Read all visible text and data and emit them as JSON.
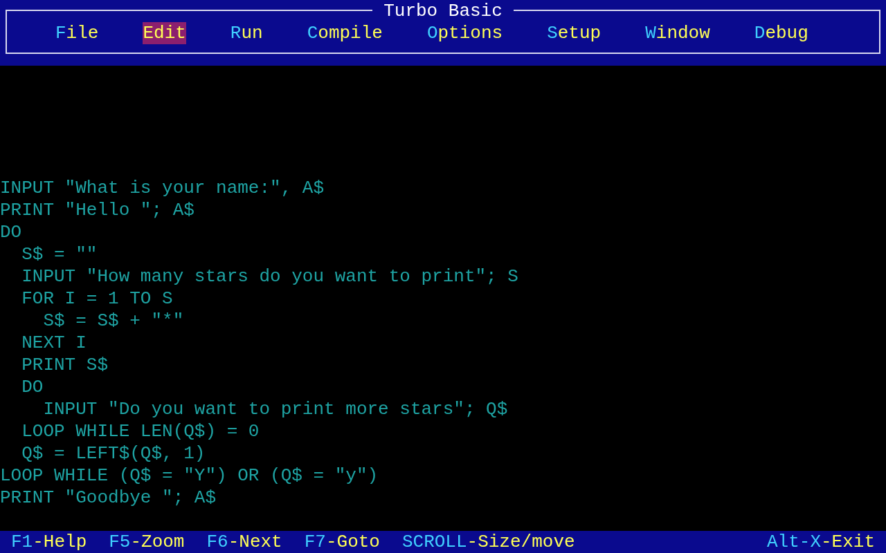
{
  "window": {
    "title": "Turbo Basic"
  },
  "menu": [
    {
      "label": "File",
      "selected": false
    },
    {
      "label": "Edit",
      "selected": true
    },
    {
      "label": "Run",
      "selected": false
    },
    {
      "label": "Compile",
      "selected": false
    },
    {
      "label": "Options",
      "selected": false
    },
    {
      "label": "Setup",
      "selected": false
    },
    {
      "label": "Window",
      "selected": false
    },
    {
      "label": "Debug",
      "selected": false
    }
  ],
  "editor": {
    "lines": [
      "INPUT \"What is your name:\", A$",
      "PRINT \"Hello \"; A$",
      "DO",
      "  S$ = \"\"",
      "  INPUT \"How many stars do you want to print\"; S",
      "  FOR I = 1 TO S",
      "    S$ = S$ + \"*\"",
      "  NEXT I",
      "  PRINT S$",
      "  DO",
      "    INPUT \"Do you want to print more stars\"; Q$",
      "  LOOP WHILE LEN(Q$) = 0",
      "  Q$ = LEFT$(Q$, 1)",
      "LOOP WHILE (Q$ = \"Y\") OR (Q$ = \"y\")",
      "PRINT \"Goodbye \"; A$"
    ]
  },
  "status_bar": {
    "left_keys": [
      {
        "key": "F1",
        "action": "-Help"
      },
      {
        "key": "F5",
        "action": "-Zoom"
      },
      {
        "key": "F6",
        "action": "-Next"
      },
      {
        "key": "F7",
        "action": "-Goto"
      },
      {
        "key": "SCROLL",
        "action": "-Size/move"
      }
    ],
    "right_keys": [
      {
        "key": "Alt-X",
        "action": "-Exit"
      }
    ]
  }
}
